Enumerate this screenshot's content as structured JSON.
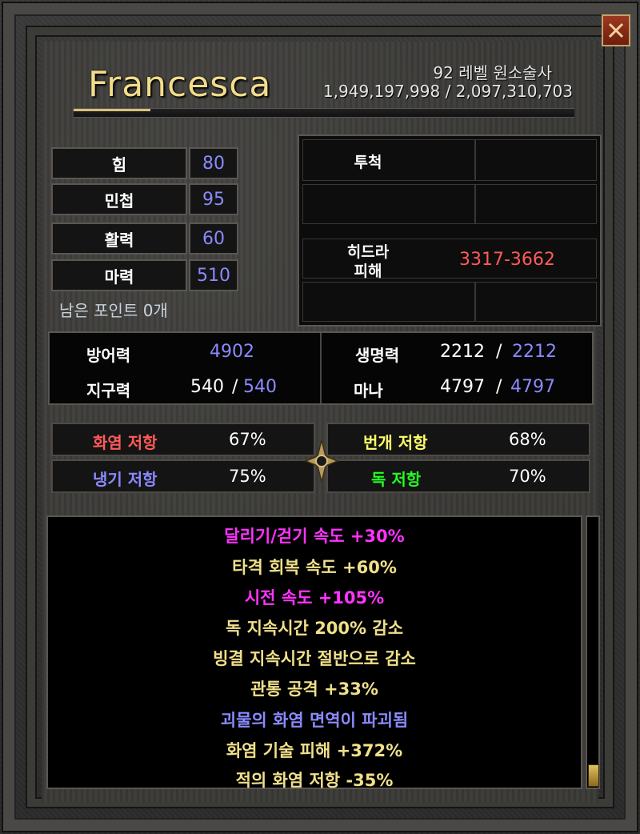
{
  "header": {
    "name": "Francesca",
    "level_class": "92 레벨 원소술사",
    "experience": "1,949,197,998 / 2,097,310,703"
  },
  "attributes": [
    {
      "label": "힘",
      "value": "80"
    },
    {
      "label": "민첩",
      "value": "95"
    },
    {
      "label": "활력",
      "value": "60"
    },
    {
      "label": "마력",
      "value": "510"
    }
  ],
  "remaining_points": "남은 포인트 0개",
  "skills": {
    "slot1_label": "투척",
    "slot3_label_line1": "히드라",
    "slot3_label_line2": "피해",
    "slot3_damage": "3317-3662"
  },
  "defense": {
    "defense_label": "방어력",
    "defense_value": "4902",
    "stamina_label": "지구력",
    "stamina_current": "540",
    "stamina_sep": "/",
    "stamina_max": "540",
    "life_label": "생명력",
    "life_current": "2212",
    "life_sep": "/",
    "life_max": "2212",
    "mana_label": "마나",
    "mana_current": "4797",
    "mana_sep": "/",
    "mana_max": "4797"
  },
  "resistances": [
    {
      "label": "화염 저항",
      "value": "67%",
      "color": "#ff5a5a"
    },
    {
      "label": "번개 저항",
      "value": "68%",
      "color": "#ffff6a"
    },
    {
      "label": "냉기 저항",
      "value": "75%",
      "color": "#8a8aff"
    },
    {
      "label": "독 저항",
      "value": "70%",
      "color": "#22ff22"
    }
  ],
  "bonuses": [
    {
      "text": "달리기/걷기 속도 +30%",
      "color": "#ff33ff"
    },
    {
      "text": "타격 회복 속도 +60%",
      "color": "#f0e08a"
    },
    {
      "text": "시전 속도 +105%",
      "color": "#ff33ff"
    },
    {
      "text": "독 지속시간 200% 감소",
      "color": "#f0e08a"
    },
    {
      "text": "빙결 지속시간 절반으로 감소",
      "color": "#f0e08a"
    },
    {
      "text": "관통 공격 +33%",
      "color": "#f0e08a"
    },
    {
      "text": "괴물의 화염 면역이 파괴됨",
      "color": "#8a8aff"
    },
    {
      "text": "화염 기술 피해 +372%",
      "color": "#f0e08a"
    },
    {
      "text": "적의 화염 저항 -35%",
      "color": "#f0e08a"
    }
  ],
  "icons": {
    "close": "close-icon",
    "emblem": "emblem-icon",
    "scroll": "scroll-thumb"
  }
}
